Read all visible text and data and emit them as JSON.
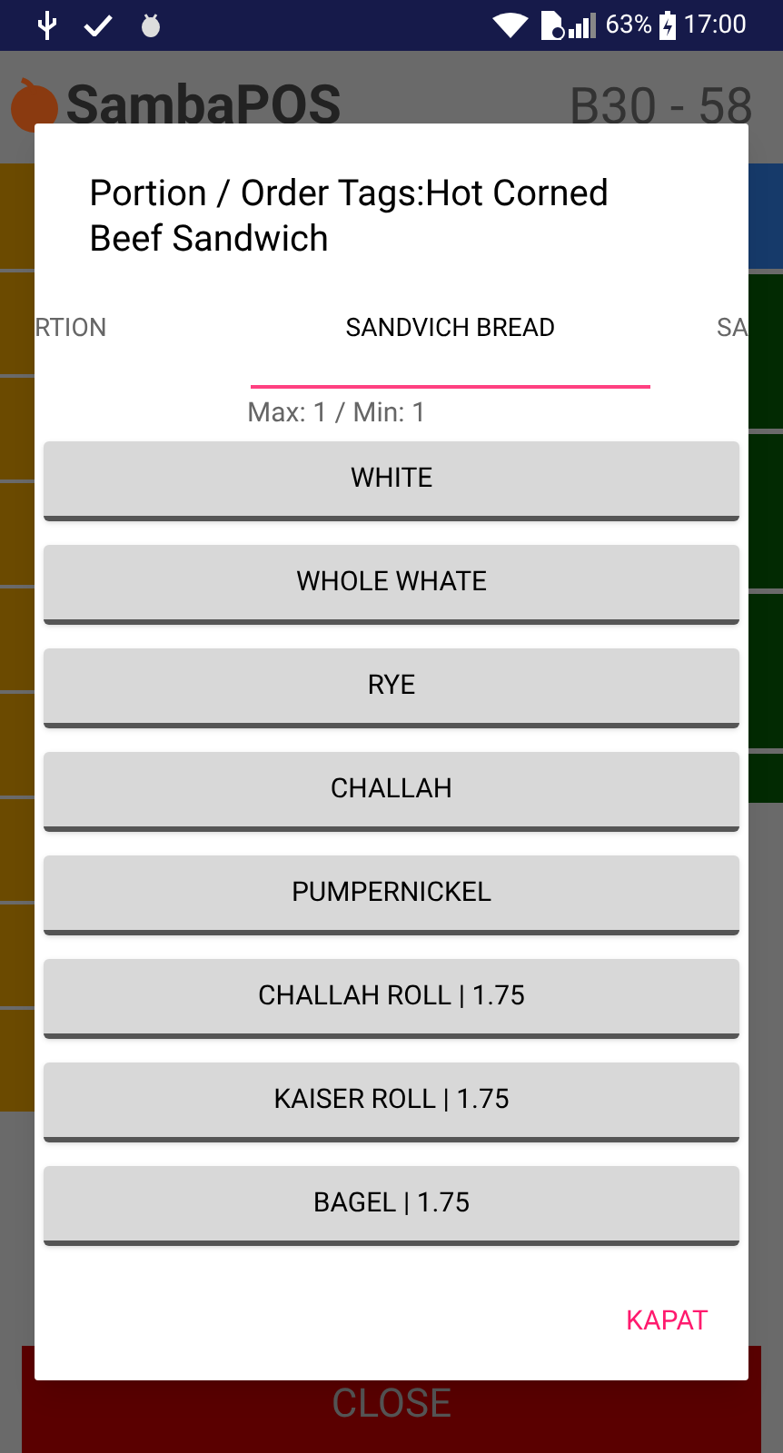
{
  "status_bar": {
    "battery": "63%",
    "time": "17:00"
  },
  "app": {
    "logo": "SambaPOS",
    "ticket": "B30 - 58",
    "close_button": "CLOSE"
  },
  "dialog": {
    "title": "Portion / Order Tags:Hot Corned Beef Sandwich",
    "tabs": [
      {
        "label": "RTION",
        "selected": false
      },
      {
        "label": "SANDVICH BREAD",
        "selected": true
      },
      {
        "label": "SA",
        "selected": false
      }
    ],
    "limits": "Max: 1 / Min: 1",
    "options": [
      {
        "label": "WHITE"
      },
      {
        "label": "WHOLE WHATE"
      },
      {
        "label": "RYE"
      },
      {
        "label": "CHALLAH"
      },
      {
        "label": "PUMPERNICKEL"
      },
      {
        "label": "CHALLAH ROLL | 1.75"
      },
      {
        "label": "KAISER ROLL | 1.75"
      },
      {
        "label": "BAGEL | 1.75"
      }
    ],
    "close_action": "KAPAT"
  }
}
